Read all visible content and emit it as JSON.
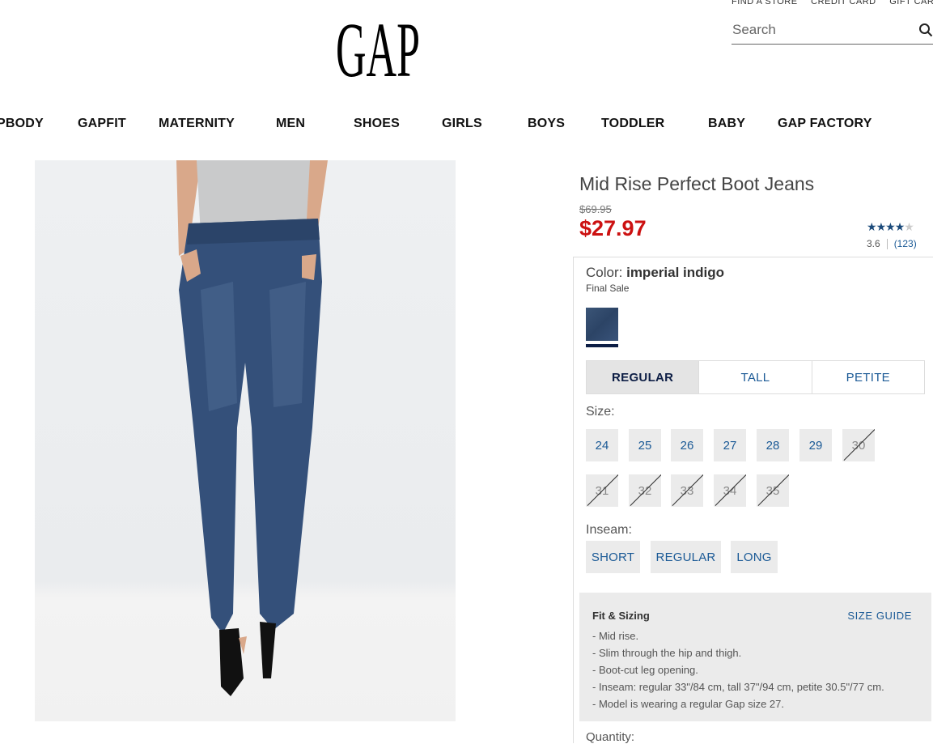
{
  "utility_links": [
    "FIND A STORE",
    "CREDIT CARD",
    "GIFT CARD"
  ],
  "brand": "GAP",
  "search": {
    "placeholder": "Search"
  },
  "nav": [
    "PBODY",
    "GAPFIT",
    "MATERNITY",
    "MEN",
    "SHOES",
    "GIRLS",
    "BOYS",
    "TODDLER",
    "BABY",
    "GAP FACTORY"
  ],
  "product": {
    "title": "Mid Rise Perfect Boot Jeans",
    "original_price": "$69.95",
    "sale_price": "$27.97",
    "rating_value": "3.6",
    "rating_count": "(123)",
    "rating_fraction": 0.72
  },
  "color": {
    "label": "Color:",
    "name": "imperial indigo",
    "note": "Final Sale",
    "swatch_color": "#2e4668"
  },
  "fit_options": [
    {
      "label": "REGULAR",
      "active": true
    },
    {
      "label": "TALL",
      "active": false
    },
    {
      "label": "PETITE",
      "active": false
    }
  ],
  "size_label": "Size:",
  "sizes": [
    {
      "label": "24",
      "available": true
    },
    {
      "label": "25",
      "available": true
    },
    {
      "label": "26",
      "available": true
    },
    {
      "label": "27",
      "available": true
    },
    {
      "label": "28",
      "available": true
    },
    {
      "label": "29",
      "available": true
    },
    {
      "label": "30",
      "available": false
    },
    {
      "label": "31",
      "available": false
    },
    {
      "label": "32",
      "available": false
    },
    {
      "label": "33",
      "available": false
    },
    {
      "label": "34",
      "available": false
    },
    {
      "label": "35",
      "available": false
    }
  ],
  "inseam_label": "Inseam:",
  "inseams": [
    "SHORT",
    "REGULAR",
    "LONG"
  ],
  "fit_sizing": {
    "heading": "Fit & Sizing",
    "guide_link": "SIZE GUIDE",
    "bullets": [
      "- Mid rise.",
      "- Slim through the hip and thigh.",
      "- Boot-cut leg opening.",
      "- Inseam: regular 33\"/84 cm, tall 37\"/94 cm, petite 30.5\"/77 cm.",
      "- Model is wearing a regular Gap size 27."
    ]
  },
  "quantity_label": "Quantity:",
  "colors": {
    "price_red": "#cc1111",
    "link_blue": "#1b5a96",
    "navy": "#0d1e45"
  }
}
